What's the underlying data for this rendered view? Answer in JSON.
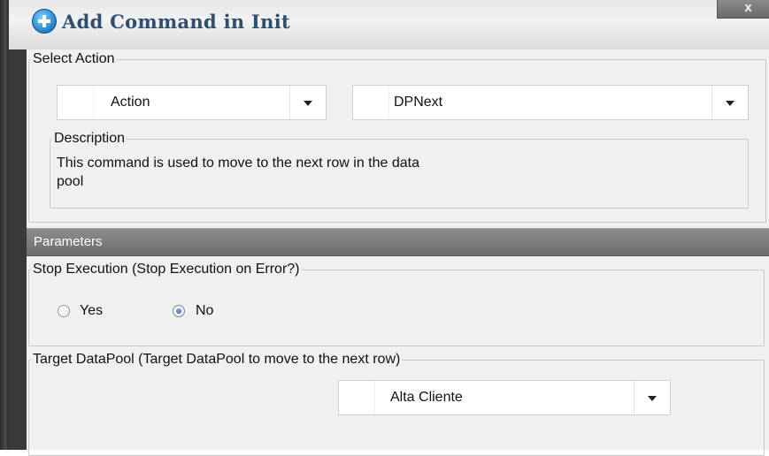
{
  "window": {
    "title": "Add Command in Init",
    "close_label": "x"
  },
  "select_action": {
    "legend": "Select Action",
    "type_combo": {
      "value": "Action"
    },
    "command_combo": {
      "value": "DPNext"
    },
    "description": {
      "legend": "Description",
      "line1": "This command is used to move to the next row in the data",
      "line2": "pool"
    }
  },
  "parameters": {
    "header": "Parameters",
    "stop_execution": {
      "legend": "Stop Execution (Stop Execution on Error?)",
      "options": [
        {
          "label": "Yes",
          "checked": false
        },
        {
          "label": "No",
          "checked": true
        }
      ]
    },
    "target_datapool": {
      "legend": "Target DataPool (Target DataPool to move to the next row)",
      "combo": {
        "value": "Alta Cliente"
      }
    }
  },
  "colors": {
    "title_text": "#2e4f6e",
    "panel_bg": "#f0f0f0",
    "header_bg": "#7a7a7a",
    "frame_dark": "#3a3a3a"
  }
}
